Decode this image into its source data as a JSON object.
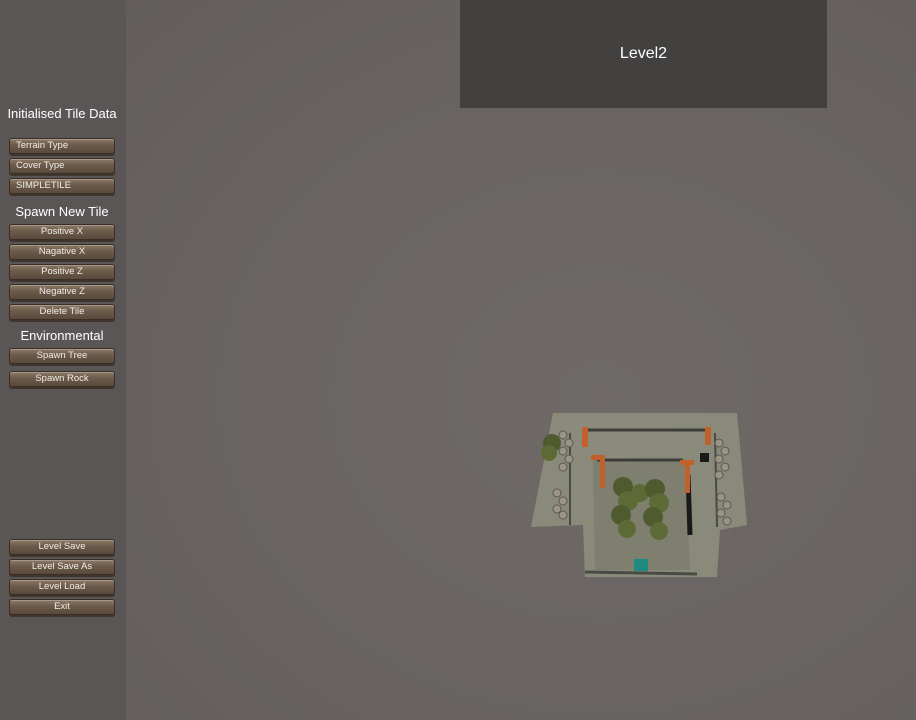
{
  "sidebar": {
    "tile_data_title": "Initialised Tile Data",
    "tile_fields": [
      "Terrain Type",
      "Cover Type",
      "SIMPLETILE"
    ],
    "spawn_title": "Spawn New Tile",
    "spawn_buttons": [
      "Positive X",
      "Nagative X",
      "Positive Z",
      "Negative Z",
      "Delete Tile"
    ],
    "env_title": "Environmental",
    "env_buttons": [
      "Spawn Tree",
      "Spawn Rock"
    ],
    "file_buttons": [
      "Level Save",
      "Level Save As",
      "Level Load",
      "Exit"
    ]
  },
  "level": {
    "name": "Level2"
  },
  "scene": {
    "icons": [
      "tree-icon",
      "rock-icon",
      "barrier-icon",
      "spawn-marker-icon"
    ]
  },
  "colors": {
    "panel_bg": "#5b5656",
    "viewport_bg": "#6b6664",
    "banner_bg": "#434040",
    "button_wood": "#6b5a4a",
    "tile_ground": "#8c8c7c",
    "tree_green": "#4f5a2e",
    "barrier_orange": "#c0602a",
    "spawn_teal": "#1f8a80"
  }
}
